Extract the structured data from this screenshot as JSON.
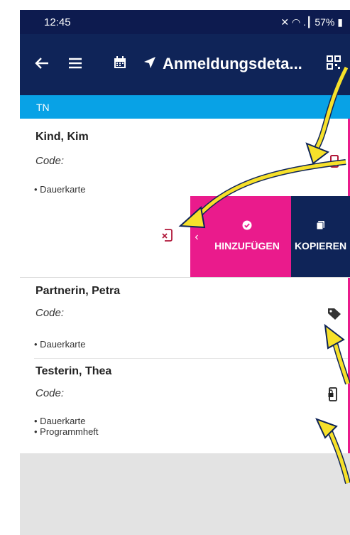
{
  "status": {
    "time": "12:45",
    "battery": "57%",
    "signal_glyphs": "✕ ◠ .┃"
  },
  "toolbar": {
    "title": "Anmeldungsdeta...",
    "icons": [
      "back-arrow-icon",
      "menu-icon",
      "calendar-icon",
      "navigation-icon",
      "qr-code-icon"
    ]
  },
  "section": {
    "label": "TN"
  },
  "participants": [
    {
      "name": "Kind, Kim",
      "code_label": "Code:",
      "items": [
        "Dauerkarte"
      ],
      "icon": "smartphone-icon"
    },
    {
      "name": "Partnerin, Petra",
      "code_label": "Code:",
      "items": [
        "Dauerkarte"
      ],
      "icon": "tag-icon"
    },
    {
      "name": "Testerin, Thea",
      "code_label": "Code:",
      "items": [
        "Dauerkarte",
        "Programmheft"
      ],
      "icon": "mobile-lock-icon"
    }
  ],
  "swipe_actions": {
    "add_label": "HINZUFÜGEN",
    "copy_label": "KOPIEREN"
  },
  "colors": {
    "status_bar": "#0d1b4f",
    "toolbar": "#0f2458",
    "section": "#08a2e6",
    "accent_pink": "#ea1b8c",
    "device_icon_red": "#b0183a",
    "annotation_arrow": "#f7e12a"
  }
}
